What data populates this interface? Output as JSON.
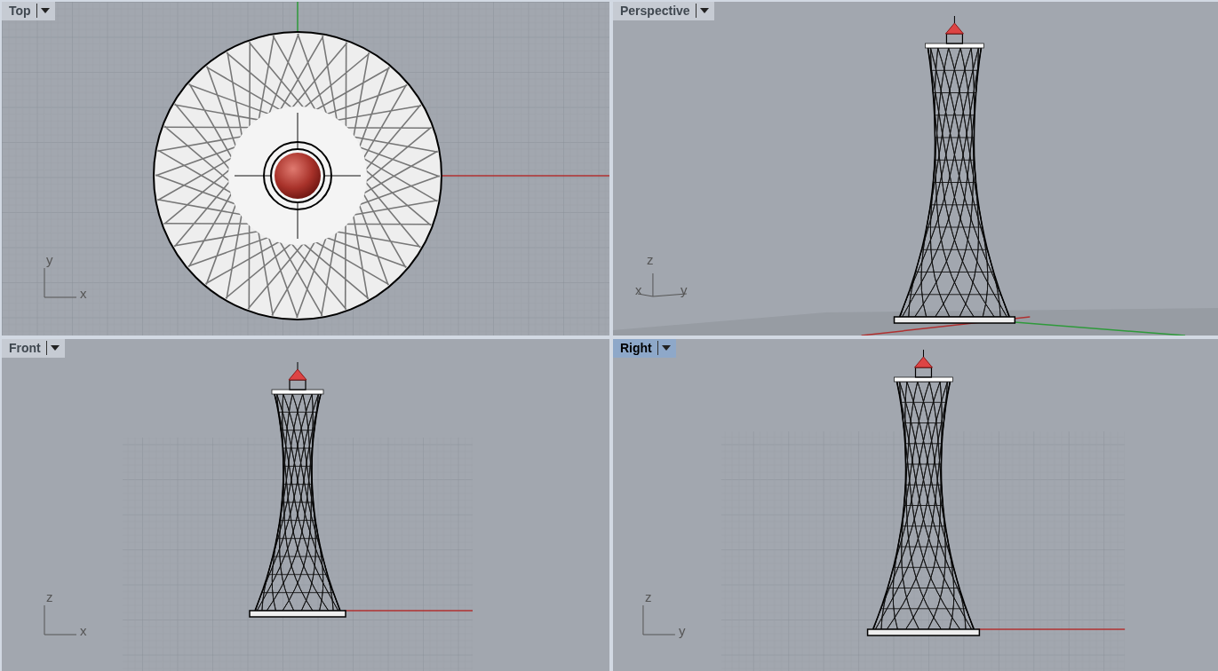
{
  "viewports": [
    {
      "title": "Top",
      "kind": "top",
      "selected": false,
      "axis_labels": [
        "y",
        "x"
      ]
    },
    {
      "title": "Perspective",
      "kind": "perspective",
      "selected": false,
      "axis_labels": [
        "z",
        "x",
        "y"
      ]
    },
    {
      "title": "Front",
      "kind": "front",
      "selected": false,
      "axis_labels": [
        "z",
        "x"
      ]
    },
    {
      "title": "Right",
      "kind": "right",
      "selected": true,
      "axis_labels": [
        "z",
        "y"
      ]
    }
  ]
}
